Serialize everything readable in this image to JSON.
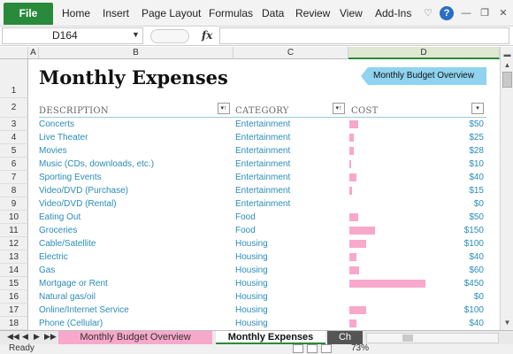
{
  "ribbon": {
    "file_label": "File",
    "tabs": [
      "Home",
      "Insert",
      "Page Layout",
      "Formulas",
      "Data",
      "Review",
      "View",
      "Add-Ins"
    ]
  },
  "formula_bar": {
    "name_box": "D164",
    "fx_label": "fx",
    "value": ""
  },
  "columns": [
    "A",
    "B",
    "C",
    "D"
  ],
  "sheet": {
    "title": "Monthly Expenses",
    "overview_button": "Monthly Budget Overview",
    "headers": {
      "description": "DESCRIPTION",
      "category": "CATEGORY",
      "cost": "COST"
    },
    "row_numbers": [
      "1",
      "2",
      "3",
      "4",
      "5",
      "6",
      "7",
      "8",
      "9",
      "10",
      "11",
      "12",
      "13",
      "14",
      "15",
      "16",
      "17",
      "18"
    ],
    "rows": [
      {
        "description": "Concerts",
        "category": "Entertainment",
        "cost": "$50",
        "value": 50
      },
      {
        "description": "Live Theater",
        "category": "Entertainment",
        "cost": "$25",
        "value": 25
      },
      {
        "description": "Movies",
        "category": "Entertainment",
        "cost": "$28",
        "value": 28
      },
      {
        "description": "Music (CDs, downloads, etc.)",
        "category": "Entertainment",
        "cost": "$10",
        "value": 10
      },
      {
        "description": "Sporting Events",
        "category": "Entertainment",
        "cost": "$40",
        "value": 40
      },
      {
        "description": "Video/DVD (Purchase)",
        "category": "Entertainment",
        "cost": "$15",
        "value": 15
      },
      {
        "description": "Video/DVD (Rental)",
        "category": "Entertainment",
        "cost": "$0",
        "value": 0
      },
      {
        "description": "Eating Out",
        "category": "Food",
        "cost": "$50",
        "value": 50
      },
      {
        "description": "Groceries",
        "category": "Food",
        "cost": "$150",
        "value": 150
      },
      {
        "description": "Cable/Satellite",
        "category": "Housing",
        "cost": "$100",
        "value": 100
      },
      {
        "description": "Electric",
        "category": "Housing",
        "cost": "$40",
        "value": 40
      },
      {
        "description": "Gas",
        "category": "Housing",
        "cost": "$60",
        "value": 60
      },
      {
        "description": "Mortgage or Rent",
        "category": "Housing",
        "cost": "$450",
        "value": 450
      },
      {
        "description": "Natural gas/oil",
        "category": "Housing",
        "cost": "$0",
        "value": 0
      },
      {
        "description": "Online/Internet Service",
        "category": "Housing",
        "cost": "$100",
        "value": 100
      },
      {
        "description": "Phone (Cellular)",
        "category": "Housing",
        "cost": "$40",
        "value": 40
      }
    ],
    "bar_max_value": 450,
    "bar_color": "#f7a8cb",
    "link_color": "#2a8cb8"
  },
  "sheet_tabs": {
    "tabs": [
      "Monthly Budget Overview",
      "Monthly Expenses",
      "Ch"
    ],
    "active": "Monthly Expenses"
  },
  "status": {
    "ready": "Ready",
    "zoom": "73%"
  }
}
